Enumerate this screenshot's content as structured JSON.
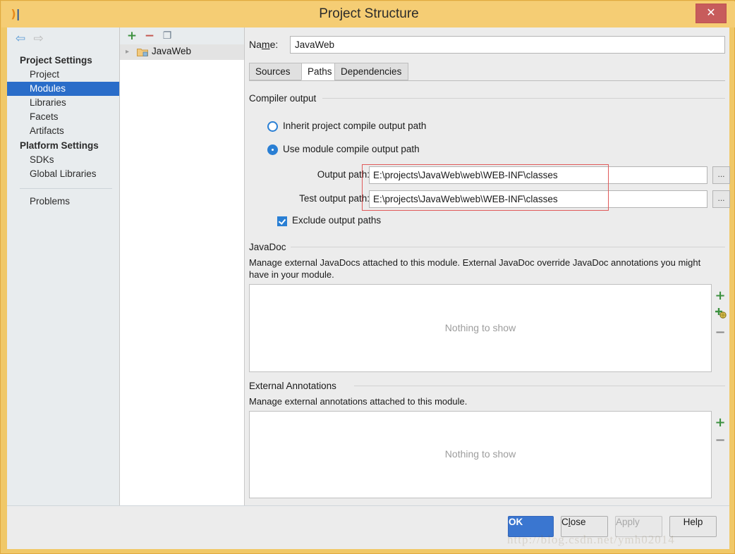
{
  "window": {
    "title": "Project Structure",
    "app_icon": "intellij-idea-icon",
    "close_label": "✕"
  },
  "nav": {
    "back_icon": "⇦",
    "forward_icon": "⇨",
    "groups": [
      {
        "label": "Project Settings",
        "items": [
          {
            "label": "Project",
            "selected": false
          },
          {
            "label": "Modules",
            "selected": true
          },
          {
            "label": "Libraries",
            "selected": false
          },
          {
            "label": "Facets",
            "selected": false
          },
          {
            "label": "Artifacts",
            "selected": false
          }
        ]
      },
      {
        "label": "Platform Settings",
        "items": [
          {
            "label": "SDKs",
            "selected": false
          },
          {
            "label": "Global Libraries",
            "selected": false
          }
        ]
      }
    ],
    "extra_items": [
      {
        "label": "Problems",
        "selected": false
      }
    ]
  },
  "tree": {
    "toolbar": {
      "add_label": "+",
      "remove_label": "−",
      "copy_label": "❐"
    },
    "chevron": "▸",
    "nodes": [
      {
        "label": "JavaWeb",
        "selected": true
      }
    ]
  },
  "pane": {
    "name_label_pre": "Na",
    "name_label_underlined": "m",
    "name_label_post": "e:",
    "name_value": "JavaWeb",
    "name_placeholder": "",
    "tabs": [
      {
        "label": "Sources",
        "active": false
      },
      {
        "label": "Paths",
        "active": true
      },
      {
        "label": "Dependencies",
        "active": false
      }
    ],
    "compiler_output": {
      "group_label": "Compiler output",
      "radio_inherit": "Inherit project compile output path",
      "radio_module": "Use module compile output path",
      "radio_selected": "module",
      "output_path_label": "Output path:",
      "output_path_value": "E:\\projects\\JavaWeb\\web\\WEB-INF\\classes",
      "test_output_path_label": "Test output path:",
      "test_output_path_value": "E:\\projects\\JavaWeb\\web\\WEB-INF\\classes",
      "browse_label": "...",
      "exclude_checkbox_label": "Exclude output paths",
      "exclude_checked": true
    },
    "javadoc": {
      "group_label": "JavaDoc",
      "description": "Manage external JavaDocs attached to this module. External JavaDoc override JavaDoc annotations you might have in your module.",
      "empty_text": "Nothing to show",
      "buttons": [
        {
          "icon": "plus-icon",
          "label": "+"
        },
        {
          "icon": "plus-globe-icon",
          "label": "+"
        },
        {
          "icon": "minus-icon",
          "label": "−"
        }
      ]
    },
    "external_annotations": {
      "group_label": "External Annotations",
      "description": "Manage external annotations attached to this module.",
      "empty_text": "Nothing to show",
      "buttons": [
        {
          "icon": "plus-icon",
          "label": "+"
        },
        {
          "icon": "minus-icon",
          "label": "−"
        }
      ]
    }
  },
  "footer": {
    "ok": "OK",
    "close_pre": "C",
    "close_underlined": "l",
    "close_post": "ose",
    "apply": "Apply",
    "apply_disabled": true,
    "help": "Help"
  },
  "overlay": {
    "watermark": "http://blog.csdn.net/ymh02014"
  },
  "colors": {
    "titlebar": "#f5cd74",
    "frame": "#f0c868",
    "selection": "#2a6dc9",
    "accent_blue": "#2a7fd4",
    "primary_button": "#3a76d0",
    "annotation_red": "#e05a5a",
    "panel_bg": "#ececec",
    "nav_bg": "#e8ecee",
    "close_button": "#c75c5c",
    "plus_green": "#3d9140",
    "minus_red": "#c4554e"
  }
}
